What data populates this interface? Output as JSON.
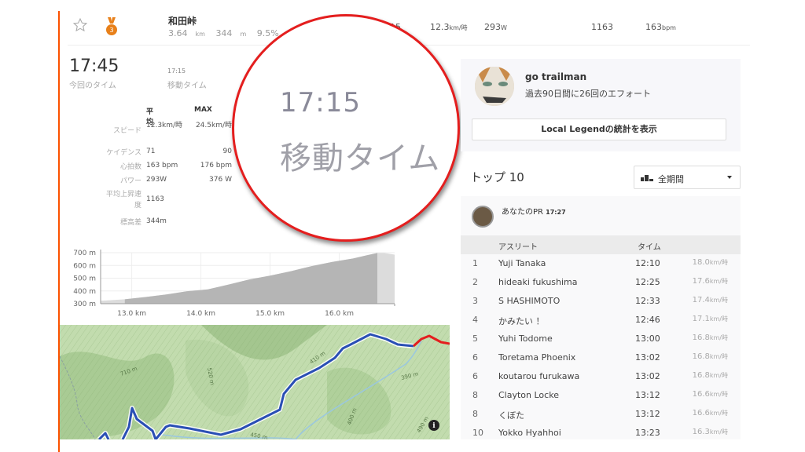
{
  "segment": {
    "name": "和田峠",
    "distance": "3.64",
    "distance_unit": "km",
    "elev_gain": "344",
    "elev_unit": "m",
    "grade": "9.5%",
    "time_partial": "15",
    "speed": "12.3",
    "speed_unit": "km/時",
    "power": "293",
    "power_unit": "W",
    "vam": "1163",
    "heart_rate": "163",
    "hr_unit": "bpm",
    "medal_rank": "3"
  },
  "effort": {
    "elapsed_time": "17:45",
    "elapsed_label": "今回のタイム",
    "moving_time": "17:15",
    "moving_label": "移動タイム"
  },
  "stats": {
    "headers": [
      "平均",
      "MAX"
    ],
    "rows": [
      {
        "label": "スピード",
        "avg": "12.3km/時",
        "max": "24.5km/時"
      },
      {
        "label": "ケイデンス",
        "avg": "71",
        "max": "90"
      },
      {
        "label": "心拍数",
        "avg": "163 bpm",
        "max": "176 bpm"
      },
      {
        "label": "パワー",
        "avg": "293W",
        "max": "376 W"
      },
      {
        "label": "平均上昇速度",
        "avg": "1163",
        "max": ""
      },
      {
        "label": "標高差",
        "avg": "344m",
        "max": ""
      }
    ]
  },
  "chart_data": {
    "type": "area",
    "title": "",
    "xlabel": "",
    "ylabel": "",
    "x_ticks": [
      "13.0 km",
      "14.0 km",
      "15.0 km",
      "16.0 km"
    ],
    "y_ticks": [
      "300 m",
      "400 m",
      "500 m",
      "600 m",
      "700 m"
    ],
    "xlim": [
      12.55,
      16.8
    ],
    "ylim": [
      300,
      700
    ],
    "segment_range_km": [
      12.9,
      16.55
    ],
    "x": [
      12.55,
      12.9,
      13.2,
      13.5,
      13.8,
      14.1,
      14.4,
      14.7,
      15.0,
      15.3,
      15.6,
      15.9,
      16.2,
      16.4,
      16.55,
      16.65,
      16.8
    ],
    "y": [
      322,
      335,
      352,
      372,
      398,
      412,
      450,
      490,
      520,
      555,
      595,
      628,
      655,
      680,
      698,
      698,
      685
    ],
    "grid": true
  },
  "map": {
    "contour_labels": [
      "710 m",
      "520 m",
      "410 m",
      "390 m",
      "450 m",
      "400 m",
      "490 m"
    ],
    "info_label": "i"
  },
  "magnifier": {
    "time": "17:15",
    "label": "移動タイム"
  },
  "local_legend": {
    "name": "go trailman",
    "subtitle": "過去90日間に26回のエフォート",
    "button_label": "Local Legendの統計を表示"
  },
  "leaderboard": {
    "title": "トップ 10",
    "period_selected": "全期間",
    "your_pr_label": "あなたのPR",
    "your_pr_time": "17:27",
    "columns": [
      "アスリート",
      "タイム"
    ],
    "speed_unit": "km/時",
    "rows": [
      {
        "rank": "1",
        "name": "Yuji Tanaka",
        "time": "12:10",
        "speed": "18.0"
      },
      {
        "rank": "2",
        "name": "hideaki fukushima",
        "time": "12:25",
        "speed": "17.6"
      },
      {
        "rank": "3",
        "name": "S HASHIMOTO",
        "time": "12:33",
        "speed": "17.4"
      },
      {
        "rank": "4",
        "name": "かみたい ！",
        "time": "12:46",
        "speed": "17.1"
      },
      {
        "rank": "5",
        "name": "Yuhi Todome",
        "time": "13:00",
        "speed": "16.8"
      },
      {
        "rank": "6",
        "name": "Toretama Phoenix",
        "time": "13:02",
        "speed": "16.8"
      },
      {
        "rank": "6",
        "name": "koutarou furukawa",
        "time": "13:02",
        "speed": "16.8"
      },
      {
        "rank": "8",
        "name": "Clayton Locke",
        "time": "13:12",
        "speed": "16.6"
      },
      {
        "rank": "8",
        "name": "くぼた",
        "time": "13:12",
        "speed": "16.6"
      },
      {
        "rank": "10",
        "name": "Yokko Hyahhoi",
        "time": "13:23",
        "speed": "16.3"
      }
    ]
  },
  "colors": {
    "accent": "#fc5200",
    "medal": "#e8801a",
    "route": "#2a4fb5",
    "route_end": "#e41e1e",
    "magnifier_ring": "#e41e1e"
  }
}
